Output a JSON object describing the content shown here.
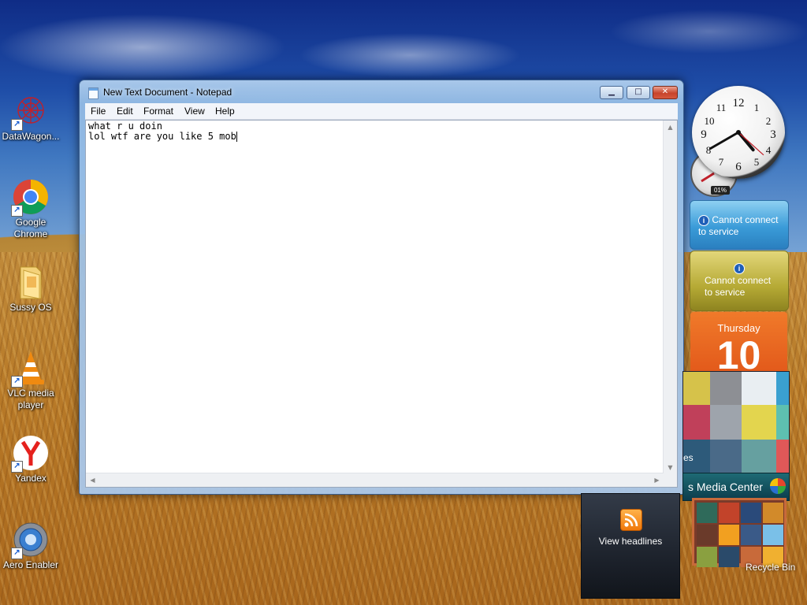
{
  "desktop": {
    "icons": [
      {
        "label": "DataWagon...",
        "icon": "datawagon-icon"
      },
      {
        "label": "Google Chrome",
        "icon": "chrome-icon"
      },
      {
        "label": "Sussy OS",
        "icon": "folder-icon"
      },
      {
        "label": "VLC media player",
        "icon": "vlc-cone-icon"
      },
      {
        "label": "Yandex",
        "icon": "yandex-icon"
      },
      {
        "label": "Aero Enabler",
        "icon": "aero-enabler-icon"
      }
    ]
  },
  "notepad": {
    "title": "New Text Document - Notepad",
    "menu": [
      "File",
      "Edit",
      "Format",
      "View",
      "Help"
    ],
    "content_line1": "what r u doin",
    "content_line2": "lol wtf are you like 5 mob"
  },
  "gadgets": {
    "clock": {
      "hour": 4,
      "minute": 40,
      "second": 22
    },
    "cpu_meter": {
      "value": "01%"
    },
    "weather": {
      "message": "Cannot connect to service"
    },
    "currency": {
      "message": "Cannot connect to service"
    },
    "calendar": {
      "day_name": "Thursday",
      "day_number": "10"
    },
    "slideshow": {
      "caption": "es"
    },
    "media_center": {
      "label": "s Media Center"
    },
    "feed_headlines": {
      "label": "View headlines"
    },
    "recycle_bin": {
      "label": "Recycle Bin"
    }
  },
  "colors": {
    "window_frame": "#a8c6e8",
    "close_button": "#c8442c",
    "calendar_orange": "#e2581a",
    "weather_blue": "#3a9bd8",
    "currency_yellow": "#b6aa35"
  }
}
